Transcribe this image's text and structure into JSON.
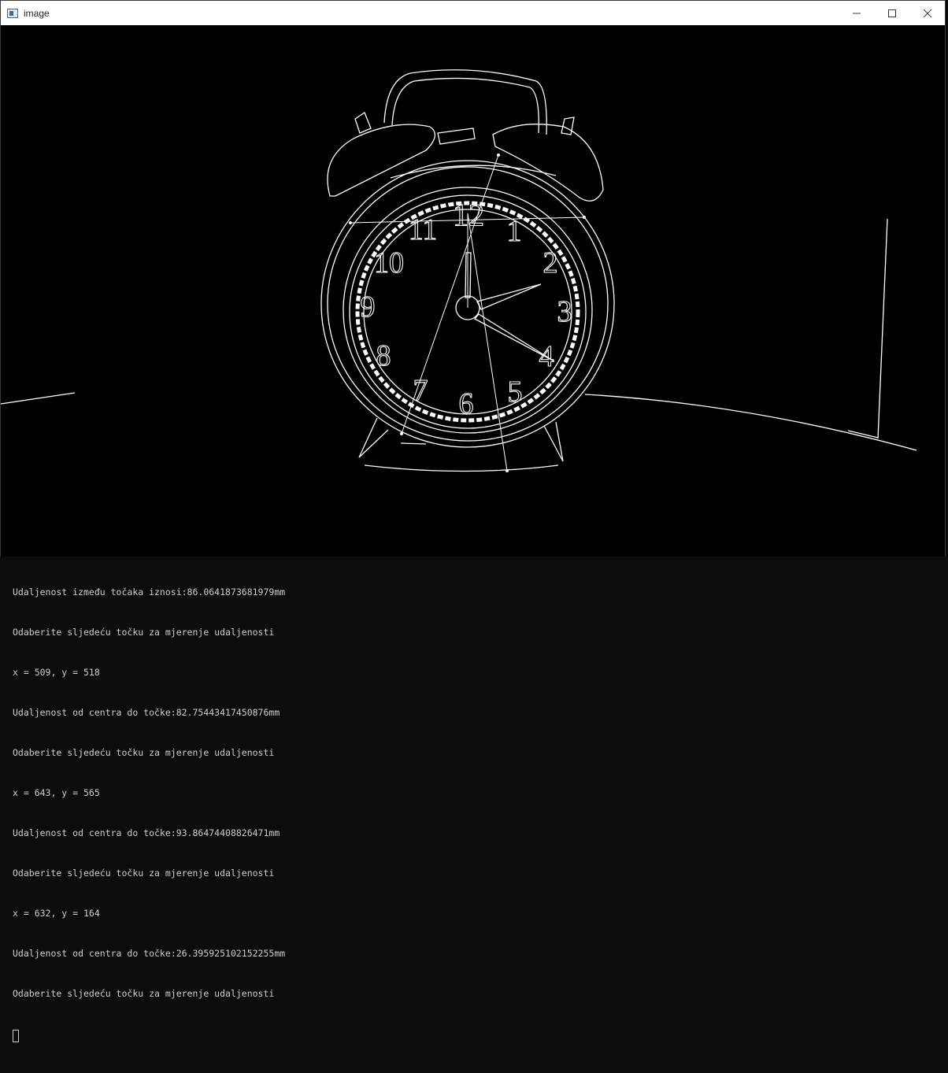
{
  "window": {
    "title": "image",
    "icons": {
      "app": "opencv-window-icon",
      "minimize": "minimize-icon",
      "maximize": "maximize-icon",
      "close": "close-icon"
    }
  },
  "clock_face": {
    "numerals": [
      "12",
      "1",
      "2",
      "3",
      "4",
      "5",
      "6",
      "7",
      "8",
      "9",
      "10",
      "11"
    ]
  },
  "console": {
    "lines": [
      "Udaljenost između točaka iznosi:86.0641873681979mm",
      "Odaberite sljedeću točku za mjerenje udaljenosti",
      "x = 509, y = 518",
      "Udaljenost od centra do točke:82.75443417450876mm",
      "Odaberite sljedeću točku za mjerenje udaljenosti",
      "x = 643, y = 565",
      "Udaljenost od centra do točke:93.86474408826471mm",
      "Odaberite sljedeću točku za mjerenje udaljenosti",
      "x = 632, y = 164",
      "Udaljenost od centra do točke:26.395925102152255mm",
      "Odaberite sljedeću točku za mjerenje udaljenosti"
    ]
  }
}
